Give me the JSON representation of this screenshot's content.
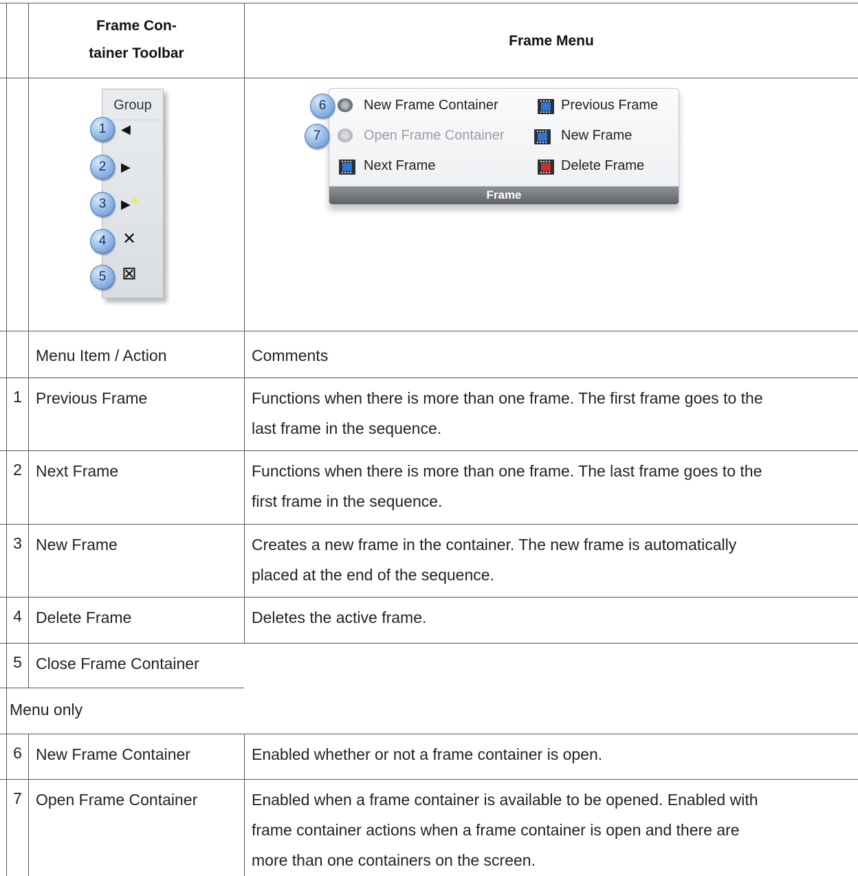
{
  "header": {
    "col1_line1": "Frame Con-",
    "col1_line2": "tainer Toolbar",
    "col2": "Frame Menu"
  },
  "toolbar_image": {
    "title": "Group",
    "buttons": [
      {
        "callout": "1",
        "glyph": "◀",
        "icon": "previous-frame-icon"
      },
      {
        "callout": "2",
        "glyph": "▶",
        "icon": "next-frame-icon"
      },
      {
        "callout": "3",
        "glyph": "▶",
        "icon": "new-frame-icon"
      },
      {
        "callout": "4",
        "glyph": "✕",
        "icon": "delete-frame-icon"
      },
      {
        "callout": "5",
        "glyph": "⊠",
        "icon": "close-frame-container-icon"
      }
    ]
  },
  "ribbon_image": {
    "footer": "Frame",
    "callouts": [
      "6",
      "7"
    ],
    "items": [
      {
        "label": "New Frame Container",
        "icon": "new-frame-container-icon",
        "enabled": true
      },
      {
        "label": "Open Frame Container",
        "icon": "open-frame-container-icon",
        "enabled": false
      },
      {
        "label": "Next Frame",
        "icon": "next-frame-icon",
        "enabled": true
      },
      {
        "label": "Previous Frame",
        "icon": "previous-frame-icon",
        "enabled": true
      },
      {
        "label": "New Frame",
        "icon": "new-frame-icon",
        "enabled": true
      },
      {
        "label": "Delete Frame",
        "icon": "delete-frame-icon",
        "enabled": true
      }
    ]
  },
  "table_header": {
    "col1": "Menu Item / Action",
    "col2": "Comments"
  },
  "rows": [
    {
      "num": "1",
      "item": "Previous Frame",
      "comment_line1": "Functions when there is more than one frame. The first frame goes to the",
      "comment_line2": "last frame in the sequence."
    },
    {
      "num": "2",
      "item": "Next Frame",
      "comment_line1": "Functions when there is more than one frame. The last frame goes to the",
      "comment_line2": "first frame in the sequence."
    },
    {
      "num": "3",
      "item": "New Frame",
      "comment_line1": "Creates a new frame in the container. The new frame is automatically",
      "comment_line2": "placed at the end of the sequence."
    },
    {
      "num": "4",
      "item": "Delete Frame",
      "comment_line1": "Deletes the active frame."
    },
    {
      "num": "5",
      "item": "Close Frame Container"
    }
  ],
  "section_label": "Menu only",
  "menu_rows": [
    {
      "num": "6",
      "item": "New Frame Container",
      "comment_line1": "Enabled whether or not a frame container is open."
    },
    {
      "num": "7",
      "item": "Open Frame Container",
      "comment_line1": "Enabled when a frame container is available to be opened. Enabled with",
      "comment_line2": "frame container actions when a frame container is open and there are",
      "comment_line3": "more than one containers on the screen."
    }
  ]
}
